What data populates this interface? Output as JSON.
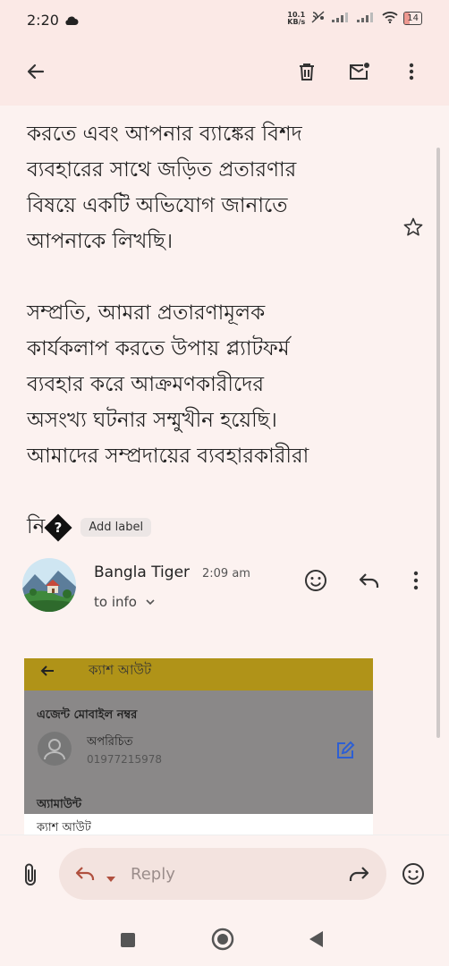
{
  "status_bar": {
    "time": "2:20",
    "net_speed_value": "10.1",
    "net_speed_unit": "KB/s",
    "battery": "14"
  },
  "toolbar": {
    "back_icon": "arrow-left-icon",
    "delete_icon": "trash-icon",
    "mark_unread_icon": "mail-unread-icon",
    "more_icon": "more-vert-icon"
  },
  "message": {
    "body": "করতে এবং আপনার ব্যাঙ্কের বিশদ\nব্যবহারের সাথে জড়িত প্রতারণার\nবিষয়ে একটি অভিযোগ জানাতে\nআপনাকে লিখছি।\n\nসম্প্রতি, আমরা প্রতারণামূলক\nকার্যকলাপ করতে উপায় প্ল্যাটফর্ম\nব্যবহার করে আক্রমণকারীদের\nঅসংখ্য ঘটনার সম্মুখীন হয়েছি।\nআমাদের সম্প্রদায়ের ব্যবহারকারীরা",
    "truncated_tail": "নি",
    "replacement_char": "?",
    "add_label": "Add label"
  },
  "sender": {
    "name": "Bangla Tiger",
    "time": "2:09 am",
    "to": "to info"
  },
  "attachment": {
    "header_title": "ক্যাশ আউট",
    "section_agent": "এজেন্ট মোবাইল নম্বর",
    "contact_name": "অপরিচিত",
    "contact_number": "01977215978",
    "section_amount": "অ্যামাউন্ট",
    "cash_out": "ক্যাশ আউট"
  },
  "reply_bar": {
    "placeholder": "Reply"
  },
  "colors": {
    "header_bg": "#fbe9e6",
    "body_bg": "#fcf2f0",
    "reply_pill": "#f3e3df",
    "attachment_header": "#b09318",
    "edit_icon": "#2d5fd3"
  }
}
